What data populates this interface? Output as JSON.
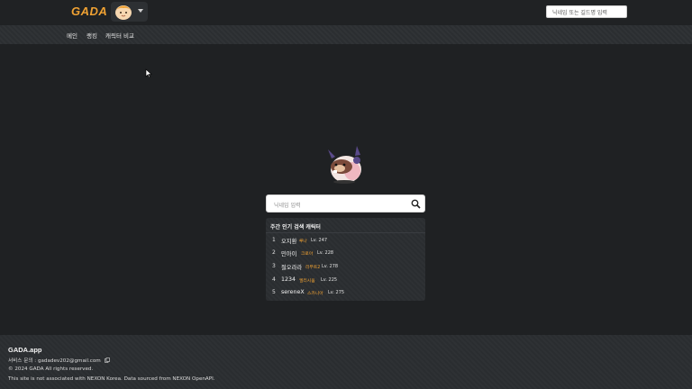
{
  "header": {
    "logo": "GADA",
    "search_placeholder": "닉네임 또는 길드명 입력"
  },
  "nav": {
    "items": [
      "메인",
      "랭킹",
      "캐릭터 비교"
    ]
  },
  "main": {
    "search_placeholder": "닉네임 입력",
    "ranking_title": "주간 인기 검색 캐릭터",
    "ranking": [
      {
        "rank": "1",
        "nickname": "오지환",
        "class": "루나",
        "level": "Lv. 247"
      },
      {
        "rank": "2",
        "nickname": "민아이",
        "class": "크로아",
        "level": "Lv. 228"
      },
      {
        "rank": "3",
        "nickname": "절오라라",
        "class": "리부트2",
        "level": "Lv. 278"
      },
      {
        "rank": "4",
        "nickname": "1234",
        "class": "엘리시움",
        "level": "Lv. 225"
      },
      {
        "rank": "5",
        "nickname": "sereneX",
        "class": "스카니아",
        "level": "Lv. 275"
      }
    ]
  },
  "footer": {
    "brand": "GADA.app",
    "contact": "서비스 문의 : gadadev202@gmail.com",
    "copyright": "© 2024 GADA All rights reserved.",
    "disclaimer": "This site is not associated with NEXON Korea. Data sourced from NEXON OpenAPI."
  },
  "colors": {
    "background": "#1f2123",
    "accent": "#f0a233",
    "panel": "#2a2d30"
  },
  "icons": {
    "search": "search-icon",
    "copy": "copy-icon",
    "caret": "chevron-down-icon"
  }
}
